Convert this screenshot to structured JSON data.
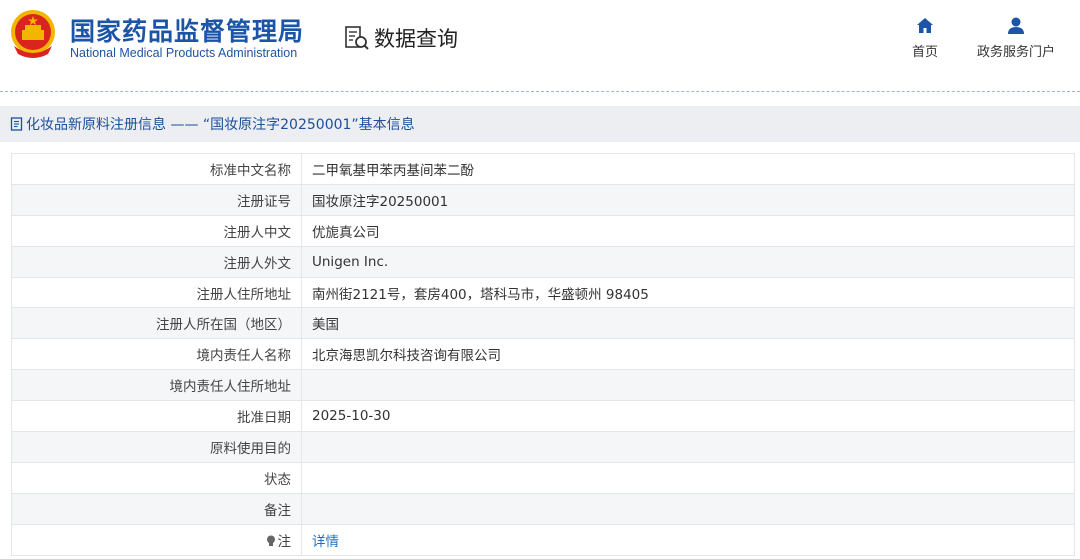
{
  "header": {
    "logo_cn": "国家药品监督管理局",
    "logo_en": "National Medical Products Administration",
    "query_title": "数据查询",
    "nav": [
      {
        "label": "首页",
        "icon": "home-icon"
      },
      {
        "label": "政务服务门户",
        "icon": "user-icon"
      }
    ]
  },
  "breadcrumb": {
    "text": "化妆品新原料注册信息 —— “国妆原注字20250001”基本信息"
  },
  "record": {
    "rows": [
      {
        "label": "标准中文名称",
        "value": "二甲氧基甲苯丙基间苯二酚"
      },
      {
        "label": "注册证号",
        "value": "国妆原注字20250001"
      },
      {
        "label": "注册人中文",
        "value": "优旎真公司"
      },
      {
        "label": "注册人外文",
        "value": "Unigen Inc."
      },
      {
        "label": "注册人住所地址",
        "value": "南州街2121号，套房400，塔科马市，华盛顿州 98405"
      },
      {
        "label": "注册人所在国（地区）",
        "value": "美国"
      },
      {
        "label": "境内责任人名称",
        "value": "北京海思凯尔科技咨询有限公司"
      },
      {
        "label": "境内责任人住所地址",
        "value": ""
      },
      {
        "label": "批准日期",
        "value": "2025-10-30"
      },
      {
        "label": "原料使用目的",
        "value": ""
      },
      {
        "label": "状态",
        "value": ""
      },
      {
        "label": "备注",
        "value": ""
      }
    ],
    "note_label": "注",
    "note_link": "详情"
  },
  "colors": {
    "brand_blue": "#1c55a8",
    "link_blue": "#1a73c8",
    "emblem_red": "#d9251d",
    "emblem_gold": "#f2b600"
  }
}
